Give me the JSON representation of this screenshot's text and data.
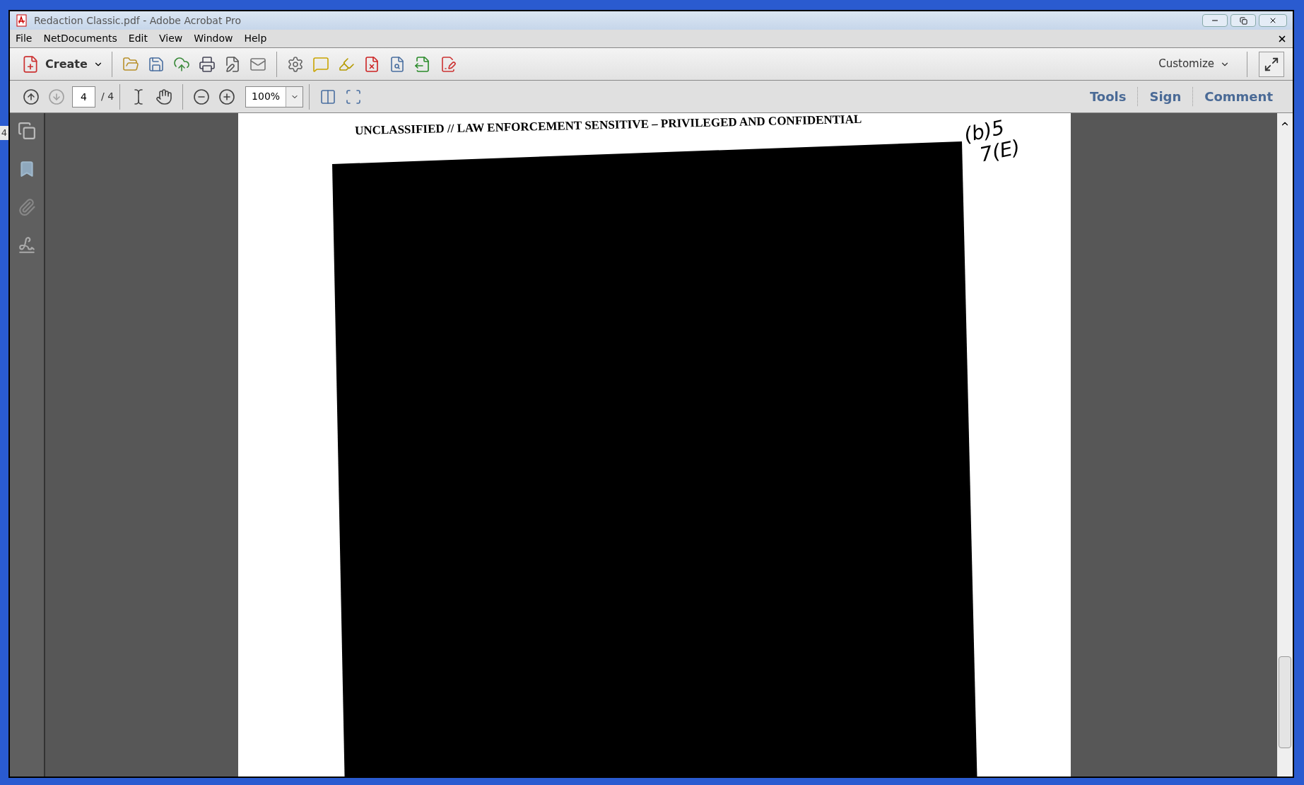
{
  "background_window": {
    "text": "4"
  },
  "window": {
    "title": "Redaction Classic.pdf - Adobe Acrobat Pro"
  },
  "menu": [
    "File",
    "NetDocuments",
    "Edit",
    "View",
    "Window",
    "Help"
  ],
  "toolbar": {
    "create_label": "Create",
    "customize_label": "Customize"
  },
  "navigation": {
    "page_number": "4",
    "page_total": "/ 4",
    "zoom": "100%",
    "previous_disabled": false,
    "next_disabled": true
  },
  "panels": [
    {
      "label": "Tools",
      "selected": false
    },
    {
      "label": "Sign",
      "selected": false
    },
    {
      "label": "Comment",
      "selected": false
    }
  ],
  "document": {
    "header": "UNCLASSIFIED // LAW ENFORCEMENT SENSITIVE – PRIVILEGED AND CONFIDENTIAL",
    "handwritten_lines": [
      "(b)5",
      "7(E)"
    ]
  }
}
